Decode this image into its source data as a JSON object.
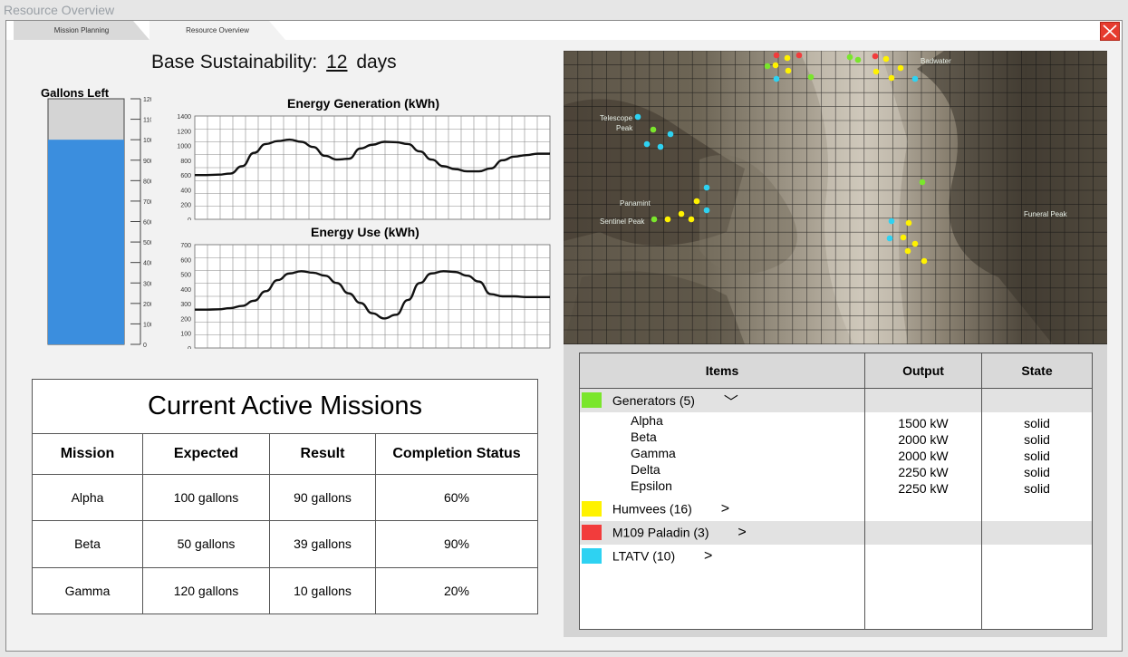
{
  "window": {
    "title": "Resource Overview"
  },
  "tabs": [
    {
      "label": "Mission Planning",
      "active": false
    },
    {
      "label": "Resource Overview",
      "active": true
    }
  ],
  "sustainability": {
    "prefix": "Base Sustainability:",
    "value": "12",
    "suffix": "days"
  },
  "gallons": {
    "title": "Gallons Left",
    "max": 1200,
    "current": 1000,
    "ticks": [
      "1200",
      "1100",
      "1000",
      "900",
      "800",
      "700",
      "600",
      "500",
      "400",
      "300",
      "200",
      "100",
      "0"
    ]
  },
  "energy_generation": {
    "title": "Energy Generation (kWh)",
    "ticks": [
      "1400",
      "1200",
      "1000",
      "800",
      "600",
      "400",
      "200",
      "0"
    ]
  },
  "energy_use": {
    "title": "Energy Use (kWh)",
    "ticks": [
      "700",
      "600",
      "500",
      "400",
      "300",
      "200",
      "100",
      "0"
    ]
  },
  "chart_data": [
    {
      "type": "line",
      "title": "Energy Generation (kWh)",
      "ylim": [
        0,
        1400
      ],
      "x": [
        0,
        1,
        2,
        3,
        4,
        5,
        6,
        7,
        8,
        9,
        10,
        11,
        12,
        13,
        14,
        15,
        16,
        17,
        18,
        19,
        20,
        21,
        22,
        23,
        24,
        25,
        26,
        27,
        28,
        29,
        30
      ],
      "values": [
        600,
        600,
        605,
        620,
        720,
        900,
        1020,
        1060,
        1080,
        1050,
        980,
        860,
        810,
        820,
        960,
        1010,
        1050,
        1045,
        1020,
        920,
        810,
        720,
        680,
        650,
        650,
        690,
        800,
        850,
        870,
        890,
        890
      ]
    },
    {
      "type": "line",
      "title": "Energy Use (kWh)",
      "ylim": [
        0,
        700
      ],
      "x": [
        0,
        1,
        2,
        3,
        4,
        5,
        6,
        7,
        8,
        9,
        10,
        11,
        12,
        13,
        14,
        15,
        16,
        17,
        18,
        19,
        20,
        21,
        22,
        23,
        24,
        25,
        26,
        27,
        28,
        29,
        30
      ],
      "values": [
        260,
        260,
        262,
        270,
        285,
        320,
        385,
        460,
        505,
        520,
        510,
        490,
        440,
        370,
        305,
        235,
        200,
        225,
        325,
        440,
        505,
        520,
        515,
        490,
        450,
        365,
        350,
        350,
        345,
        345,
        345
      ]
    },
    {
      "type": "bar",
      "title": "Gallons Left",
      "categories": [
        "Gallons Left"
      ],
      "values": [
        1000
      ],
      "ylim": [
        0,
        1200
      ]
    }
  ],
  "missions": {
    "title": "Current Active Missions",
    "columns": [
      "Mission",
      "Expected",
      "Result",
      "Completion Status"
    ],
    "rows": [
      {
        "mission": "Alpha",
        "expected": "100 gallons",
        "result": "90 gallons",
        "status": "60%"
      },
      {
        "mission": "Beta",
        "expected": "50 gallons",
        "result": "39 gallons",
        "status": "90%"
      },
      {
        "mission": "Gamma",
        "expected": "120 gallons",
        "result": "10 gallons",
        "status": "20%"
      }
    ]
  },
  "map": {
    "labels": [
      "Telescope",
      "Peak",
      "Panamint",
      "Sentinel Peak",
      "Badwater",
      "Funeral Peak"
    ]
  },
  "items_table": {
    "columns": [
      "Items",
      "Output",
      "State"
    ],
    "groups": [
      {
        "label": "Generators (5)",
        "color": "#7ae62c",
        "chevron": "﹀",
        "expanded": true,
        "children": [
          {
            "name": "Alpha",
            "output": "1500 kW",
            "state": "solid"
          },
          {
            "name": "Beta",
            "output": "2000 kW",
            "state": "solid"
          },
          {
            "name": "Gamma",
            "output": "2000 kW",
            "state": "solid"
          },
          {
            "name": "Delta",
            "output": "2250 kW",
            "state": "solid"
          },
          {
            "name": "Epsilon",
            "output": "2250 kW",
            "state": "solid"
          }
        ]
      },
      {
        "label": "Humvees (16)",
        "color": "#fff200",
        "chevron": ">",
        "expanded": false
      },
      {
        "label": "M109 Paladin (3)",
        "color": "#f23c3c",
        "chevron": ">",
        "expanded": false
      },
      {
        "label": "LTATV (10)",
        "color": "#2ed2f2",
        "chevron": ">",
        "expanded": false
      }
    ]
  }
}
